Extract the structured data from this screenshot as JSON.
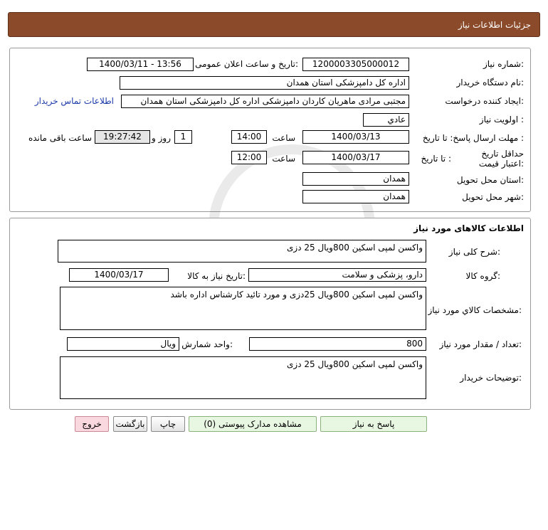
{
  "header": {
    "title": "جزئیات اطلاعات نیاز"
  },
  "info": {
    "need_number_label": "شماره نیاز:",
    "need_number": "1200003305000012",
    "announce_label": "تاریخ و ساعت اعلان عمومی:",
    "announce_value": "1400/03/11 - 13:56",
    "buyer_org_label": "نام دستگاه خریدار:",
    "buyer_org": "اداره کل دامپزشکی استان همدان",
    "requester_label": "ایجاد کننده درخواست:",
    "requester": "مجتبی مرادی ماهریان کاردان دامپزشکی اداره کل دامپزشکی استان همدان",
    "contact_link": "اطلاعات تماس خریدار",
    "priority_label": "اولویت نیاز :",
    "priority": "عادي",
    "deadline_label": "مهلت ارسال پاسخ: تا تاریخ :",
    "deadline_date": "1400/03/13",
    "time_label": "ساعت",
    "deadline_time": "14:00",
    "days": "1",
    "days_label": "روز و",
    "remaining": "19:27:42",
    "remaining_label": "ساعت باقی مانده",
    "validity_label": "حداقل تاریخ اعتبار قیمت:",
    "validity_to_label": "تا تاریخ :",
    "validity_date": "1400/03/17",
    "validity_time_label": "ساعت",
    "validity_time": "12:00",
    "province_label": "استان محل تحویل:",
    "province": "همدان",
    "city_label": "شهر محل تحویل:",
    "city": "همدان"
  },
  "goods": {
    "section_title": "اطلاعات کالاهای مورد نیاز",
    "general_desc_label": "شرح کلی نیاز:",
    "general_desc": "واکسن لمپی اسکین 800ویال 25 دزی",
    "group_label": "گروه کالا:",
    "group": "دارو، پزشکی و سلامت",
    "need_date_label": "تاریخ نیاز به کالا:",
    "need_date": "1400/03/17",
    "spec_label": "مشخصات کالاي مورد نياز:",
    "spec": "واکسن لمپی اسکین 800ویال 25دزی و مورد تائید کارشناس اداره باشد",
    "qty_label": "تعداد / مقدار مورد نیاز:",
    "qty": "800",
    "unit_label": "واحد شمارش:",
    "unit": "ویال",
    "buyer_notes_label": "توضیحات خریدار:",
    "buyer_notes": "واکسن لمپی اسکین 800ویال 25 دزی"
  },
  "buttons": {
    "reply": "پاسخ به نیاز",
    "attachments": "مشاهده مدارک پیوستی (0)",
    "print": "چاپ",
    "back": "بازگشت",
    "exit": "خروج"
  }
}
